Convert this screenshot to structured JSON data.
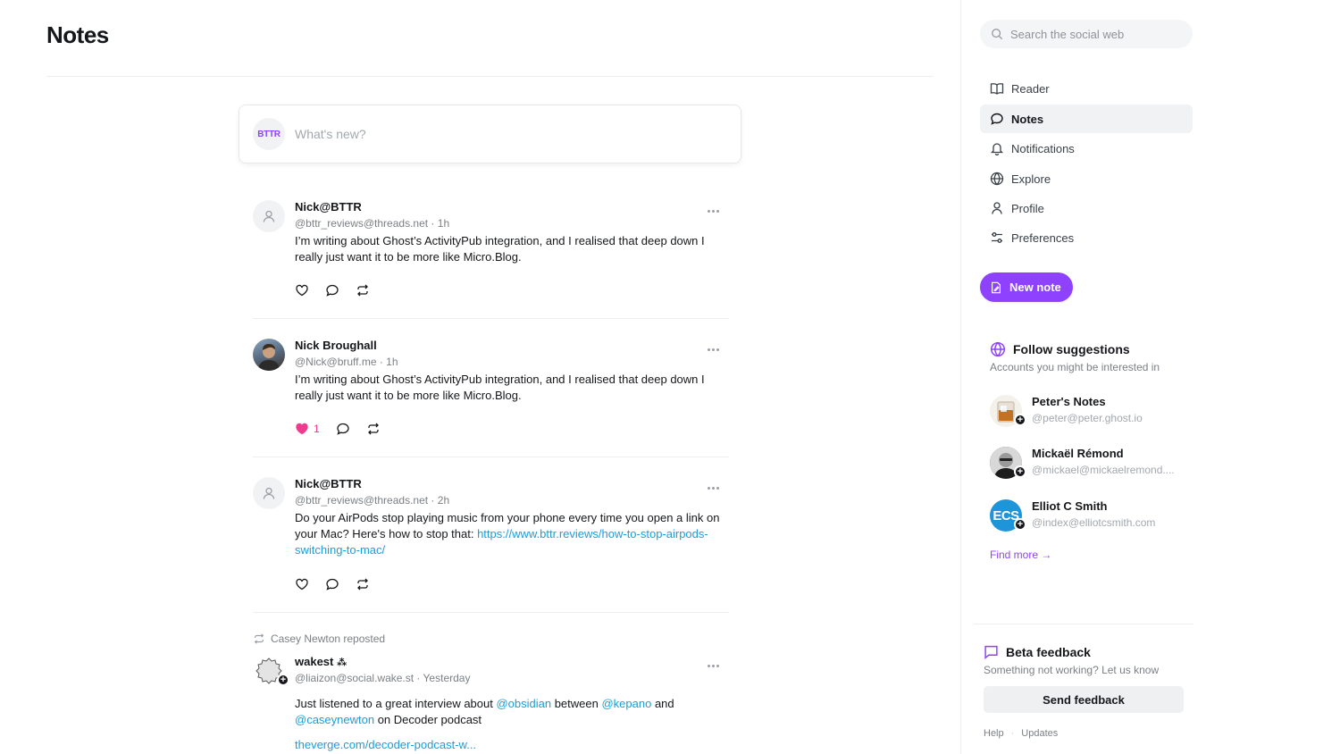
{
  "main": {
    "title": "Notes",
    "composer": {
      "avatar_text": "BTTR",
      "placeholder": "What's new?"
    },
    "notes": [
      {
        "name": "Nick@BTTR",
        "handle": "@bttr_reviews@threads.net",
        "time": "1h",
        "body": "I’m writing about Ghost’s ActivityPub integration, and I realised that deep down I really just want it to be more like Micro.Blog.",
        "likes": ""
      },
      {
        "name": "Nick Broughall",
        "handle": "@Nick@bruff.me",
        "time": "1h",
        "body": "I’m writing about Ghost’s ActivityPub integration, and I realised that deep down I really just want it to be more like Micro.Blog.",
        "likes": "1"
      },
      {
        "name": "Nick@BTTR",
        "handle": "@bttr_reviews@threads.net",
        "time": "2h",
        "body_text": "Do your AirPods stop playing music from your phone every time you open a link on your Mac? Here's how to stop that: ",
        "body_link": "https://www.bttr.reviews/how-to-stop-airpods-switching-to-mac/"
      },
      {
        "reposted_by": "Casey Newton reposted",
        "name": "wakest",
        "name_glyph": "⁂",
        "handle": "@liaizon@social.wake.st",
        "time": "Yesterday",
        "body_part1": "Just listened to a great interview about ",
        "mention1": "@obsidian",
        "body_part2": " between ",
        "mention2": "@kepano",
        "body_part3": " and ",
        "mention3": "@caseynewton",
        "body_part4": " on Decoder podcast",
        "link": "theverge.com/decoder-podcast-w..."
      }
    ]
  },
  "sidebar": {
    "search_placeholder": "Search the social web",
    "nav": [
      {
        "label": "Reader",
        "icon": "book-icon"
      },
      {
        "label": "Notes",
        "icon": "speech-bubble-icon",
        "active": true
      },
      {
        "label": "Notifications",
        "icon": "bell-icon"
      },
      {
        "label": "Explore",
        "icon": "globe-icon"
      },
      {
        "label": "Profile",
        "icon": "user-icon"
      },
      {
        "label": "Preferences",
        "icon": "sliders-icon"
      }
    ],
    "new_note_label": "New note",
    "follow": {
      "title": "Follow suggestions",
      "subtitle": "Accounts you might be interested in",
      "accounts": [
        {
          "name": "Peter's Notes",
          "handle": "@peter@peter.ghost.io"
        },
        {
          "name": "Mickaël Rémond",
          "handle": "@mickael@mickaelremond...."
        },
        {
          "name": "Elliot C Smith",
          "handle": "@index@elliotcsmith.com",
          "avatar_text": "ECS"
        }
      ],
      "find_more": "Find more →"
    },
    "feedback": {
      "title": "Beta feedback",
      "subtitle": "Something not working? Let us know",
      "button": "Send feedback"
    },
    "footer": {
      "help": "Help",
      "sep": "·",
      "updates": "Updates"
    }
  },
  "colors": {
    "accent": "#8e42ff",
    "link": "#1b9ed8",
    "like": "#ef3b8d"
  }
}
